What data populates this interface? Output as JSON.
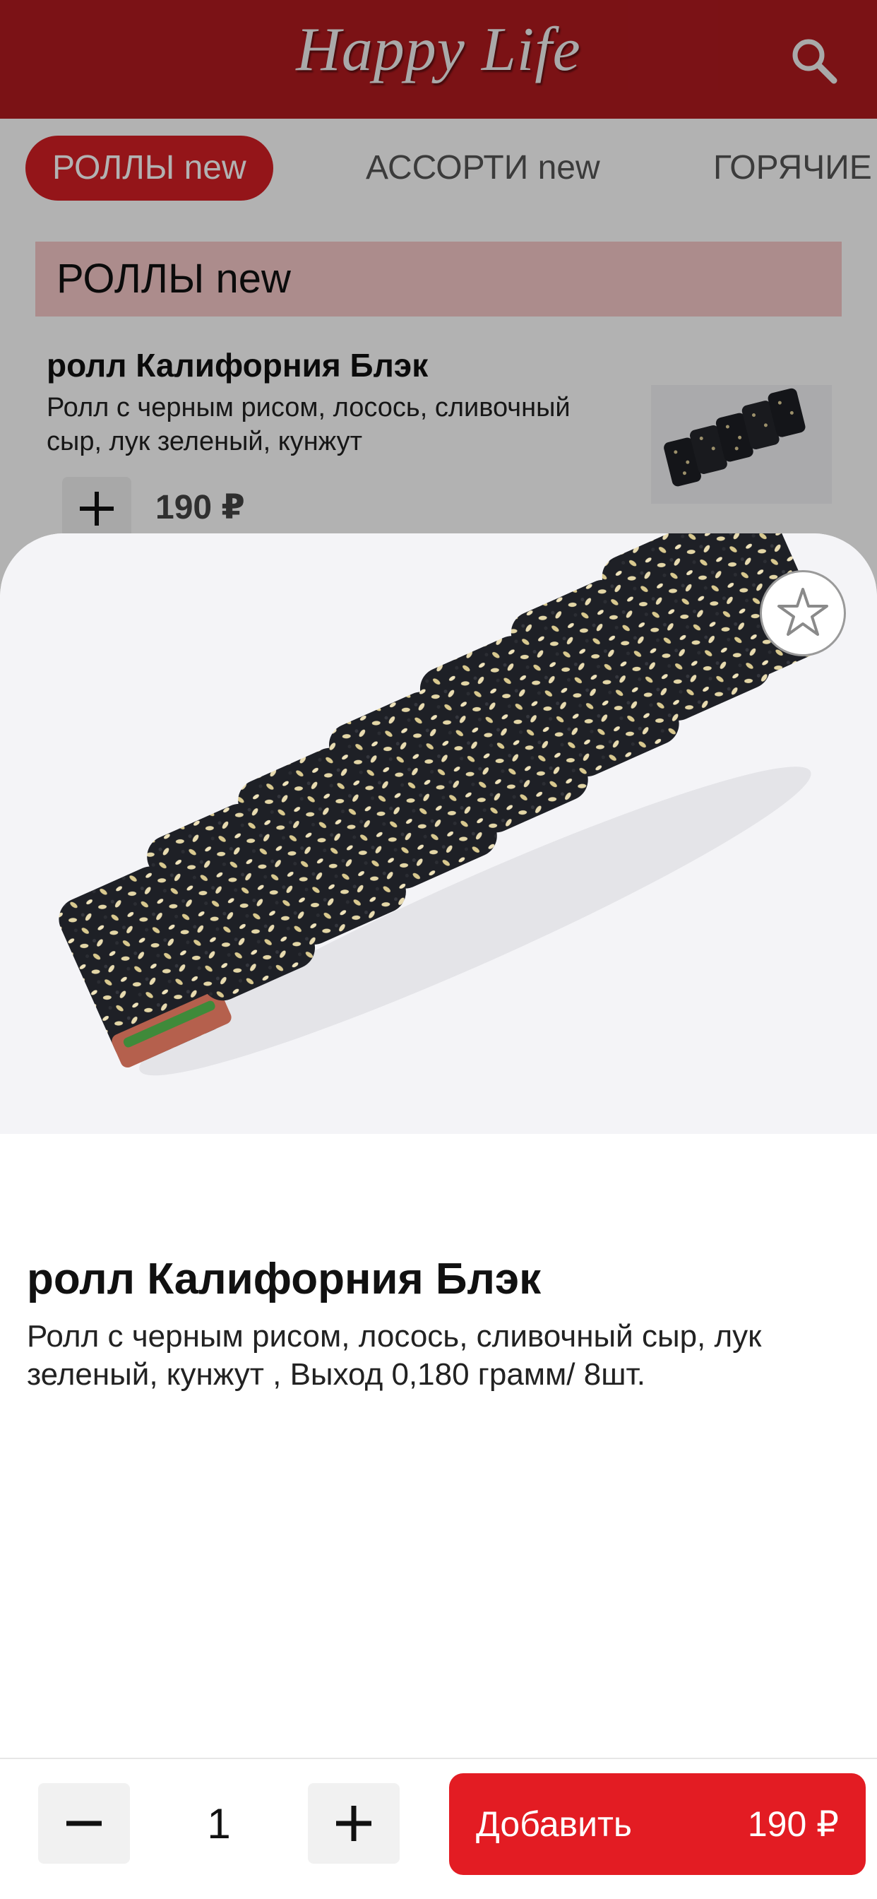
{
  "app": {
    "logo_text": "Happy Life",
    "brand_color": "#b01a1f",
    "accent_color": "#e31c23"
  },
  "tabs": [
    {
      "label": "РОЛЛЫ new",
      "active": true
    },
    {
      "label": "АССОРТИ new",
      "active": false
    },
    {
      "label": "ГОРЯЧИЕ",
      "active": false
    }
  ],
  "section": {
    "title": "РОЛЛЫ new"
  },
  "list_item": {
    "name": "ролл Калифорния Блэк",
    "description": "Ролл с черным рисом, лосось, сливочный сыр, лук зеленый, кунжут",
    "price": "190 ₽",
    "add_icon": "plus-icon"
  },
  "detail": {
    "name": "ролл Калифорния Блэк",
    "description": "Ролл с черным рисом, лосось, сливочный сыр, лук зеленый, кунжут , Выход 0,180 грамм/ 8шт.",
    "favorite_icon": "star-icon"
  },
  "cart": {
    "quantity": "1",
    "decrement_icon": "minus-icon",
    "increment_icon": "plus-icon",
    "add_label": "Добавить",
    "add_price": "190 ₽"
  },
  "icons": {
    "search": "search-icon"
  }
}
